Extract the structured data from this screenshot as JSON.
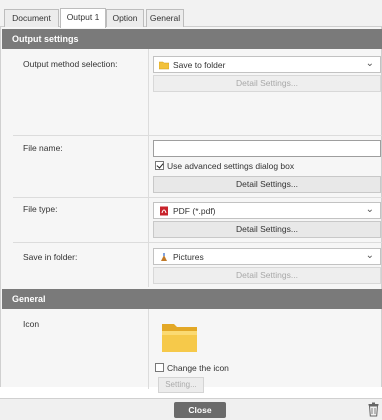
{
  "tabs": [
    "Document",
    "Output 1",
    "Option",
    "General"
  ],
  "output_settings": {
    "header": "Output settings",
    "method_label": "Output method selection:",
    "method_value": "Save to folder",
    "method_detail": "Detail Settings...",
    "filename_label": "File name:",
    "filename_value": "",
    "advanced_checkbox": "Use advanced settings dialog box",
    "filename_detail": "Detail Settings...",
    "filetype_label": "File type:",
    "filetype_value": "PDF (*.pdf)",
    "filetype_detail": "Detail Settings...",
    "savein_label": "Save in folder:",
    "savein_value": "Pictures",
    "savein_detail": "Detail Settings..."
  },
  "general": {
    "header": "General",
    "icon_label": "Icon",
    "change_icon": "Change the icon",
    "setting_button": "Setting..."
  },
  "footer": {
    "close": "Close"
  },
  "icons": {
    "folder": "folder-icon",
    "pdf": "pdf-icon",
    "pictures": "pictures-icon",
    "trash": "trash-icon"
  },
  "colors": {
    "section_header": "#7a7a7a",
    "folder_yellow": "#f2c13a",
    "pdf_red": "#c8232c",
    "close_button": "#6b6b6b"
  }
}
